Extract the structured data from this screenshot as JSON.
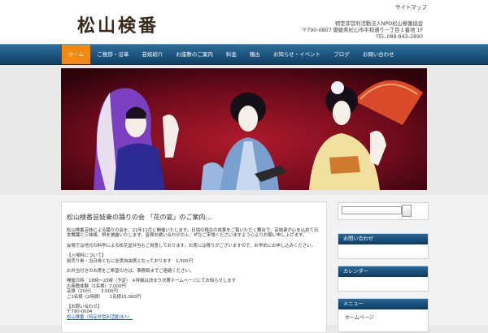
{
  "header": {
    "logo": "松山検番",
    "top_link": "サイトマップ",
    "address_line1": "特定非営利活動法人NPO松山検番協会",
    "address_line2": "〒790-0807 愛媛県松山市平和通り一丁目１番地 1F",
    "address_line3": "TEL.089-943-2890"
  },
  "nav": {
    "items": [
      {
        "label": "ホーム",
        "active": true
      },
      {
        "label": "ご挨拶・沿革"
      },
      {
        "label": "芸妓紹介"
      },
      {
        "label": "お座敷のご案内"
      },
      {
        "label": "料金"
      },
      {
        "label": "稽古"
      },
      {
        "label": "お知らせ・イベント"
      },
      {
        "label": "ブログ"
      },
      {
        "label": "お問い合わせ"
      }
    ]
  },
  "main": {
    "title": "松山検番芸妓衆の踊りの会 「花の宴」のご案内…",
    "p1": "松山検番芸妓による踊りの会を、21年11月に開催いたします。日頃の稽古の成果をご覧いただく舞台で、芸妓衆が心を込めて日本舞踊と三味線、唄を披露いたします。皆様お誘い合わせの上、ぜひご来場くださいますよう心よりお願い申し上げます。",
    "p2": "会場では地元の料亭による松花堂弁当もご用意しております。お席には限りがございますので、お早めにお申し込みください。",
    "p3": "【入場料について】",
    "p4": "前売り券・当日券ともに全席自由席となっております　1,500円",
    "p5": "お弁当付きのお席をご希望の方は、事務局までご連絡ください。",
    "p6": "開催日時：18時〜23時（予定） ※詳細は決まり次第ホームページにてお知らせします",
    "p7": "お座敷体験（1名様）7,000円",
    "p8": "芸妓（20分）　　3,500円",
    "p9": "ご1名様（2時間）　　1名様15,000円",
    "p10": "【お問い合わせ】",
    "p11": "〒790-0004",
    "p12": "松山検番（特定非営利活動法人）"
  },
  "sidebar": {
    "search_placeholder": "",
    "widget1_title": "お問い合わせ",
    "widget2_title": "カレンダー",
    "widget3_title": "メニュー",
    "widget3_item": "ホームページ"
  }
}
